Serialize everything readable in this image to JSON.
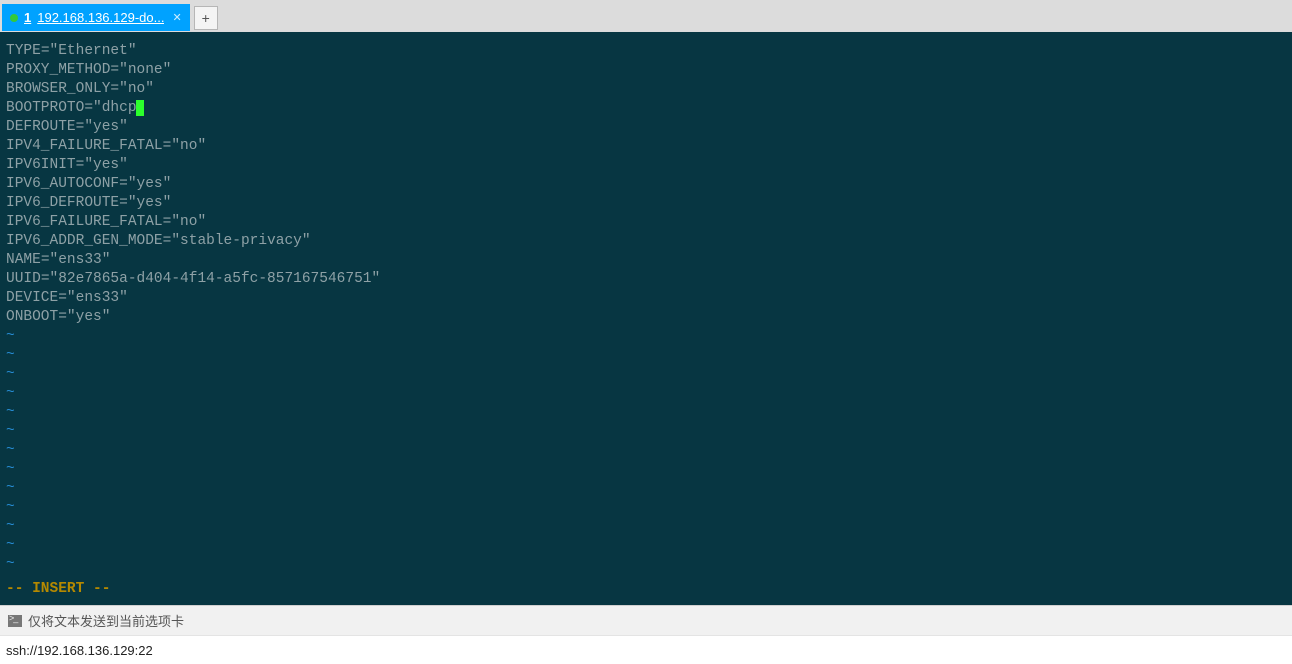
{
  "tab": {
    "indicator_color": "#34c93a",
    "number": "1",
    "title": "192.168.136.129-do..."
  },
  "file": {
    "pairs": [
      {
        "key": "TYPE",
        "value": "Ethernet",
        "cursor": false
      },
      {
        "key": "PROXY_METHOD",
        "value": "none",
        "cursor": false
      },
      {
        "key": "BROWSER_ONLY",
        "value": "no",
        "cursor": false
      },
      {
        "key": "BOOTPROTO",
        "value": "dhcp",
        "cursor": true
      },
      {
        "key": "DEFROUTE",
        "value": "yes",
        "cursor": false
      },
      {
        "key": "IPV4_FAILURE_FATAL",
        "value": "no",
        "cursor": false
      },
      {
        "key": "IPV6INIT",
        "value": "yes",
        "cursor": false
      },
      {
        "key": "IPV6_AUTOCONF",
        "value": "yes",
        "cursor": false
      },
      {
        "key": "IPV6_DEFROUTE",
        "value": "yes",
        "cursor": false
      },
      {
        "key": "IPV6_FAILURE_FATAL",
        "value": "no",
        "cursor": false
      },
      {
        "key": "IPV6_ADDR_GEN_MODE",
        "value": "stable-privacy",
        "cursor": false
      },
      {
        "key": "NAME",
        "value": "ens33",
        "cursor": false
      },
      {
        "key": "UUID",
        "value": "82e7865a-d404-4f14-a5fc-857167546751",
        "cursor": false
      },
      {
        "key": "DEVICE",
        "value": "ens33",
        "cursor": false
      },
      {
        "key": "ONBOOT",
        "value": "yes",
        "cursor": false
      }
    ],
    "empty_lines": 13,
    "tilde": "~",
    "mode": "-- INSERT --"
  },
  "status_tip": "仅将文本发送到当前选项卡",
  "connection": "ssh://192.168.136.129:22"
}
